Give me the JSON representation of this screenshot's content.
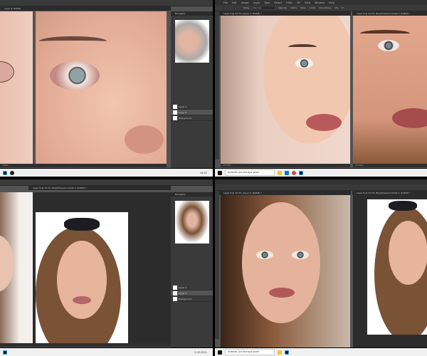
{
  "menu": [
    "File",
    "Edit",
    "Image",
    "Layer",
    "Type",
    "Select",
    "Filter",
    "3D",
    "View",
    "Window",
    "Help"
  ],
  "options": {
    "mode_label": "Mode:",
    "mode_value": "Normal",
    "opacity_label": "Opacity:",
    "opacity_value": "100%",
    "flow_label": "Flow:",
    "flow_value": "100%",
    "smoothing_label": "Smoothing:",
    "smoothing_value": "0%",
    "angle": "0°"
  },
  "quadrants": {
    "tl": {
      "doc_tab": "Layer 8, RGB/8",
      "status": "100%",
      "panel_tab": "Navigator",
      "layers": [
        "Layer 1",
        "Layer 2",
        "Background"
      ]
    },
    "tr": {
      "doc_tab_left": "Layer 8 @ 33.3% (Layer 5, RGB/8) *",
      "doc_tab_right": "Layer 8 @ 33.3% (Brightness/Contrast 1, RGB/8) *",
      "status_left": "33.33%",
      "status_right": "33.33%"
    },
    "bl": {
      "doc_tab": "Layer 8 @ 33.3% (Brightness/Contrast 1, RGB/8) *",
      "panel_tab": "Navigator",
      "layers": [
        "Layer 1",
        "Layer 2",
        "Background"
      ]
    },
    "br": {
      "doc_tab_left": "Layer 8 @ 33.3% (Layer 5, RGB/8) *",
      "doc_tab_right": "Layer 8 @ 33.3% (Brightness/Contrast 1, RGB/8) *"
    }
  },
  "taskbar": {
    "search_placeholder": "Aramak için buraya yazın",
    "time": "18:52",
    "date": "2.05.2021"
  },
  "colors": {
    "ui_dark": "#535353",
    "panel": "#3a3a3a",
    "skin": "#e8b9a2",
    "ps_blue": "#31a8ff"
  }
}
